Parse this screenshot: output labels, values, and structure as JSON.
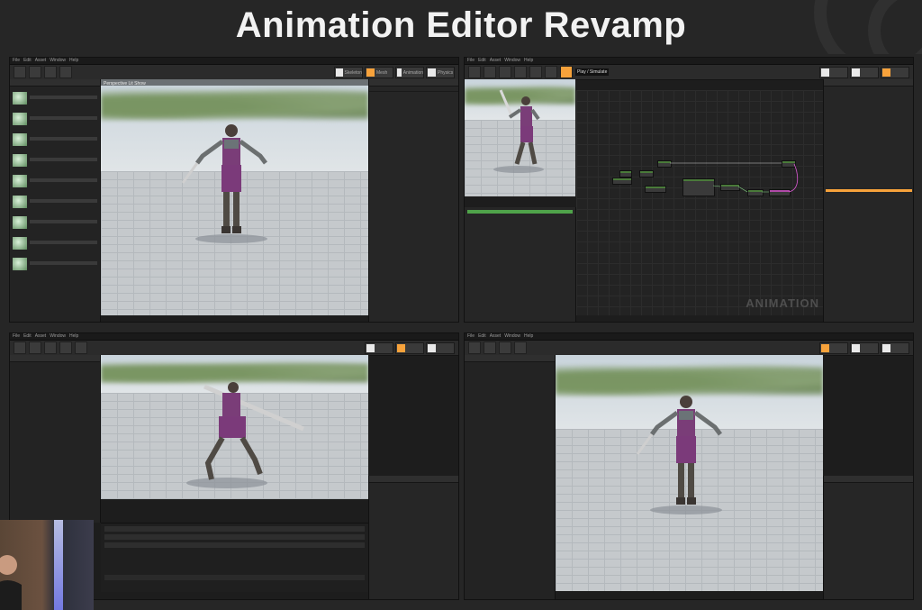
{
  "slide": {
    "title": "Animation Editor Revamp"
  },
  "panels": [
    {
      "id": "top-left",
      "menu": [
        "File",
        "Edit",
        "Asset",
        "Window",
        "Help"
      ],
      "mode_labels": [
        "Skeleton",
        "Mesh",
        "Animation",
        "Physics"
      ],
      "viewport_label": "Perspective  Lit  Show"
    },
    {
      "id": "top-right",
      "menu": [
        "File",
        "Edit",
        "Asset",
        "Window",
        "Help"
      ],
      "graph_watermark": "ANIMATION",
      "tooltip": "Play / Simulate"
    },
    {
      "id": "bottom-left",
      "menu": [
        "File",
        "Edit",
        "Asset",
        "Window",
        "Help"
      ]
    },
    {
      "id": "bottom-right",
      "menu": [
        "File",
        "Edit",
        "Asset",
        "Window",
        "Help"
      ]
    }
  ],
  "colors": {
    "accent_orange": "#f7a23b",
    "node_green": "#4a7a3a",
    "selection_green": "#4fa34a",
    "background": "#262626"
  },
  "icons": [
    "save-icon",
    "browse-icon",
    "play-icon",
    "settings-icon"
  ]
}
